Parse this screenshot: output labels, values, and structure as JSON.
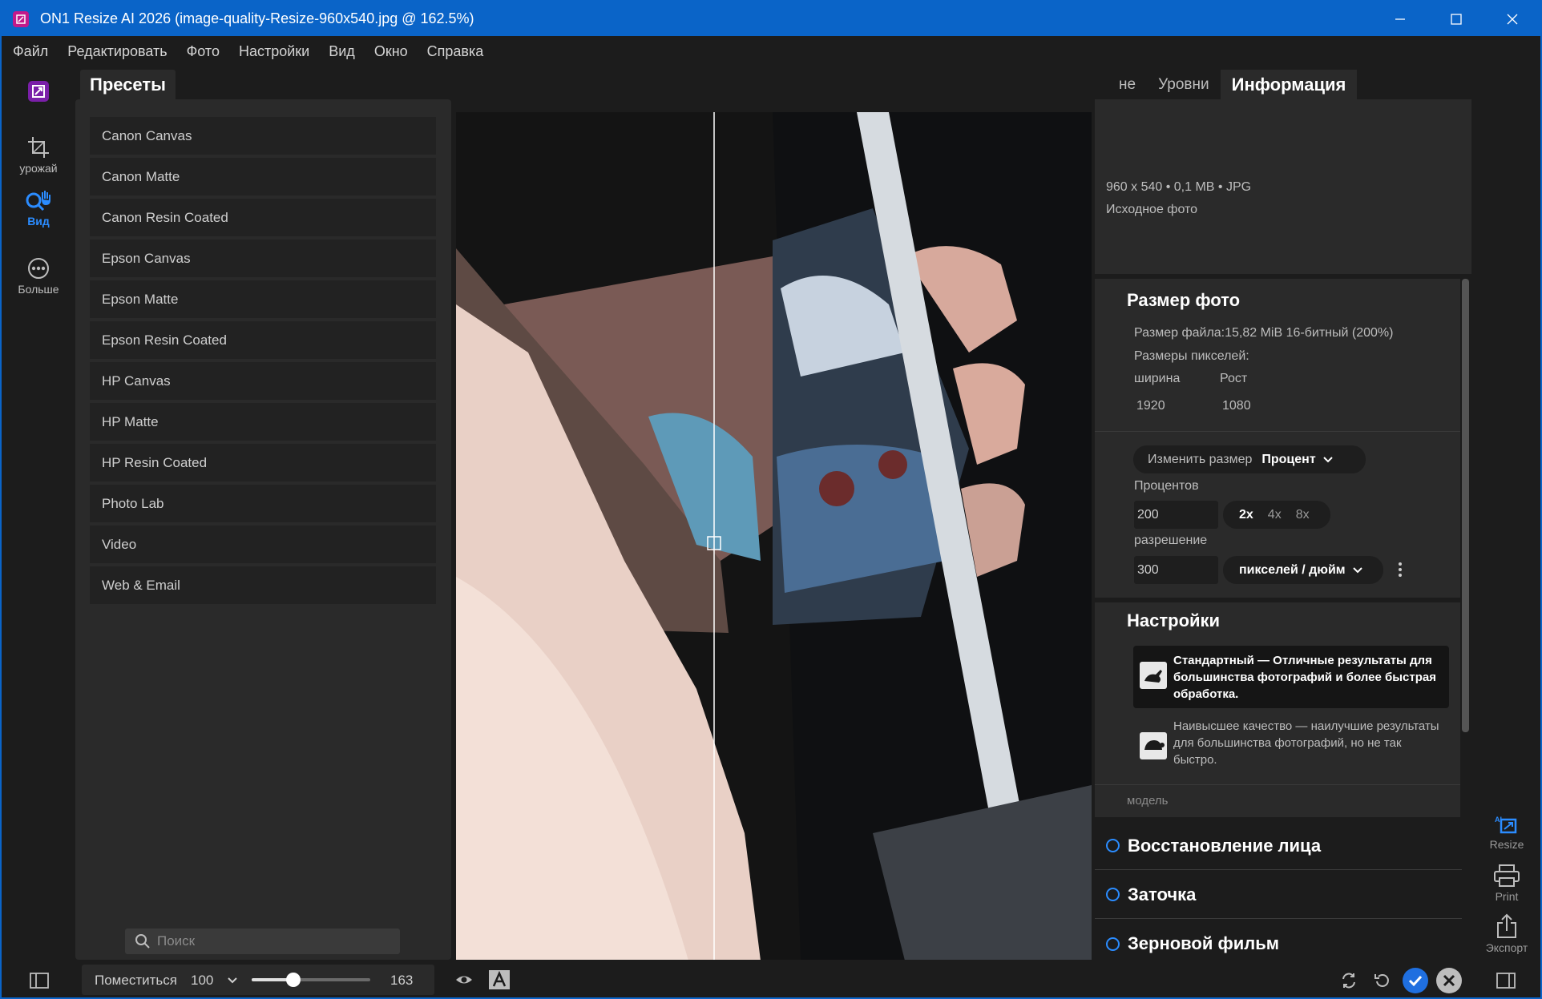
{
  "window": {
    "title": "ON1 Resize AI 2026 (image-quality-Resize-960x540.jpg @ 162.5%)"
  },
  "menu": [
    "Файл",
    "Редактировать",
    "Фото",
    "Настройки",
    "Вид",
    "Окно",
    "Справка"
  ],
  "left_tools": [
    {
      "label": "урожай",
      "icon": "crop-icon"
    },
    {
      "label": "Вид",
      "icon": "zoom-hand-icon",
      "active": true
    },
    {
      "label": "Больше",
      "icon": "more-icon"
    }
  ],
  "presets": {
    "tab": "Пресеты",
    "items": [
      "Canon Canvas",
      "Canon Matte",
      "Canon Resin Coated",
      "Epson Canvas",
      "Epson Matte",
      "Epson Resin Coated",
      "HP Canvas",
      "HP Matte",
      "HP Resin Coated",
      "Photo Lab",
      "Video",
      "Web & Email"
    ],
    "search_placeholder": "Поиск"
  },
  "right_tabs": [
    "не",
    "Уровни",
    "Информация"
  ],
  "info": {
    "dims": "960 x 540 • 0,1 MB • JPG",
    "source": "Исходное фото"
  },
  "photo_size": {
    "title": "Размер фото",
    "file_size": "Размер файла:15,82 MiB 16-битный (200%)",
    "pixel_dims": "Размеры пикселей:",
    "width_label": "ширина",
    "height_label": "Рост",
    "width": "1920",
    "height": "1080",
    "resize_label": "Изменить размер",
    "resize_mode": "Процент",
    "percent_label": "Процентов",
    "percent_value": "200",
    "multipliers": [
      "2x",
      "4x",
      "8x"
    ],
    "resolution_label": "разрешение",
    "resolution_value": "300",
    "resolution_unit": "пикселей / дюйм"
  },
  "settings": {
    "title": "Настройки",
    "option_standard": "Стандартный — Отличные результаты для большинства фотографий и более быстрая обработка.",
    "option_best": "Наивысшее качество — наилучшие результаты для большинства фотографий, но не так быстро.",
    "model_label": "модель"
  },
  "sections": [
    "Восстановление лица",
    "Заточка",
    "Зерновой фильм"
  ],
  "right_tools": [
    {
      "label": "Resize",
      "icon": "ai-resize-icon"
    },
    {
      "label": "Print",
      "icon": "printer-icon"
    },
    {
      "label": "Экспорт",
      "icon": "export-icon"
    }
  ],
  "bottom": {
    "fit_label": "Поместиться",
    "zoom_value": "100",
    "zoom_level": "163",
    "slider_fraction": 0.35
  },
  "colors": {
    "accent": "#2b8cff",
    "titlebar": "#0a64c8"
  }
}
